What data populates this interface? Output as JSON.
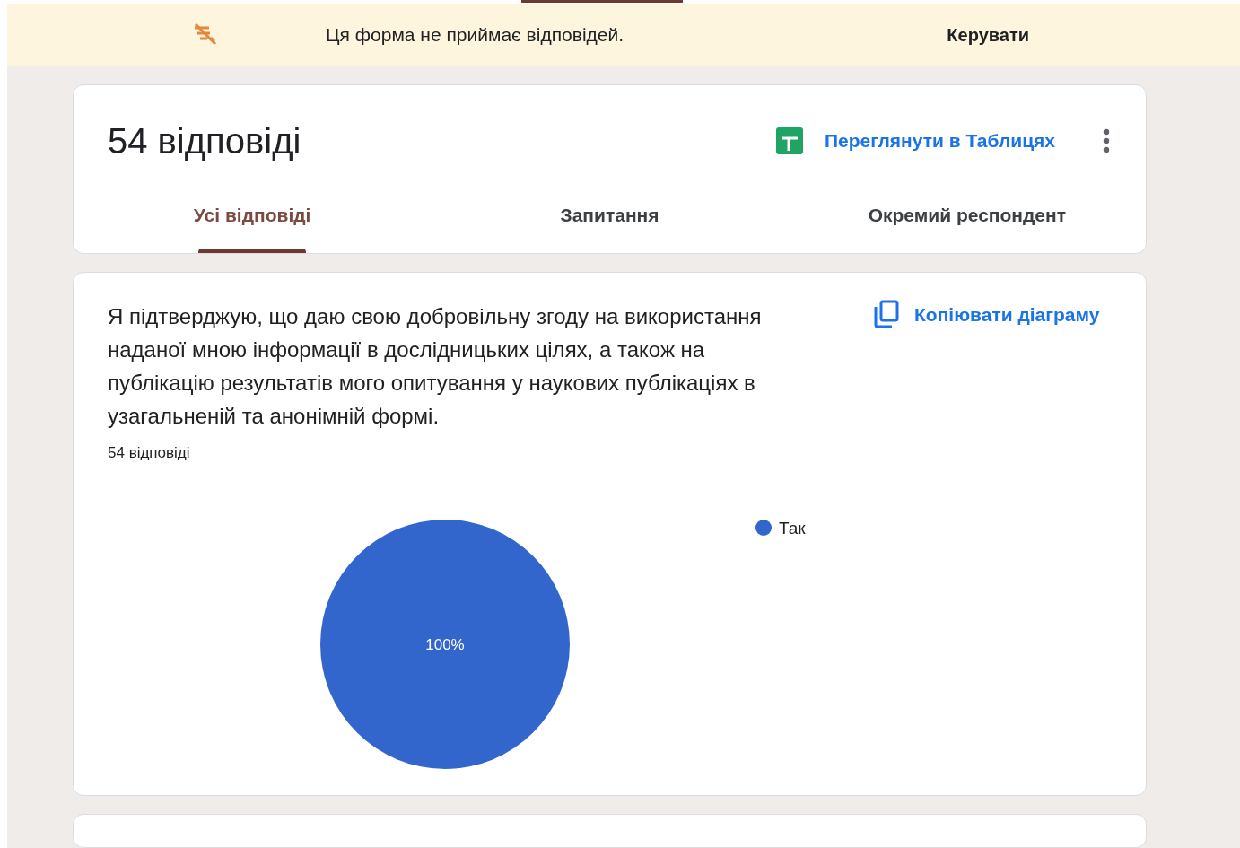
{
  "banner": {
    "message": "Ця форма не приймає відповідей.",
    "action": "Керувати"
  },
  "summary": {
    "title": "54 відповіді",
    "sheets_link": "Переглянути в Таблицях",
    "tabs": [
      {
        "label": "Усі відповіді",
        "selected": true
      },
      {
        "label": "Запитання",
        "selected": false
      },
      {
        "label": "Окремий респондент",
        "selected": false
      }
    ]
  },
  "question": {
    "text": "Я підтверджую, що даю свою добровільну згоду на використання наданої мною інформації в дослідницьких цілях, а також на публікацію результатів мого опитування у наукових публікаціях в узагальненій та анонімній формі.",
    "count": "54 відповіді",
    "copy_chart": "Копіювати діаграму",
    "chart_data": {
      "type": "pie",
      "categories": [
        "Так"
      ],
      "series": [
        {
          "color": "#3366cc",
          "values": [
            100
          ]
        }
      ],
      "value_labels": [
        "100%"
      ]
    }
  }
}
